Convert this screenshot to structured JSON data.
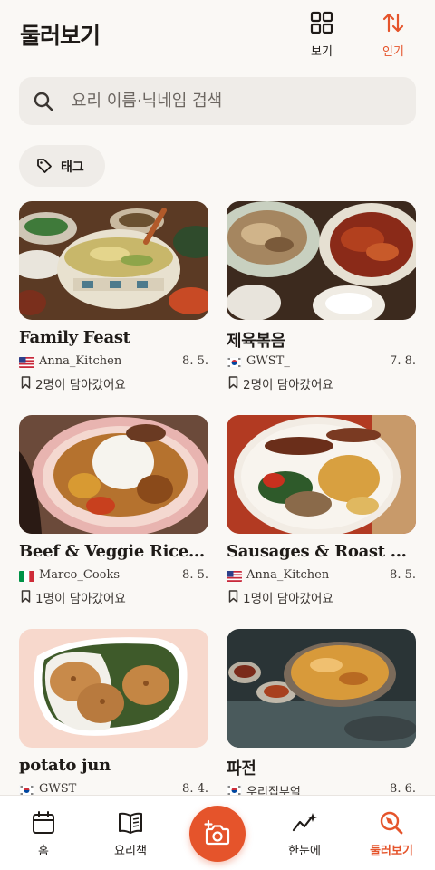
{
  "header": {
    "title": "둘러보기",
    "view_label": "보기",
    "popular_label": "인기"
  },
  "search": {
    "placeholder": "요리 이름·닉네임 검색"
  },
  "tag_filter": {
    "label": "태그"
  },
  "cards": [
    {
      "title": "Family Feast",
      "flag": "us",
      "author": "Anna_Kitchen",
      "date": "8. 5.",
      "saved": "2명이 담아갔어요"
    },
    {
      "title": "제육볶음",
      "flag": "kr",
      "author": "GWST_",
      "date": "7. 8.",
      "saved": "2명이 담아갔어요"
    },
    {
      "title": "Beef & Veggie Rice...",
      "flag": "it",
      "author": "Marco_Cooks",
      "date": "8. 5.",
      "saved": "1명이 담아갔어요"
    },
    {
      "title": "Sausages & Roast ...",
      "flag": "us",
      "author": "Anna_Kitchen",
      "date": "8. 5.",
      "saved": "1명이 담아갔어요"
    },
    {
      "title": "potato jun",
      "flag": "kr",
      "author": "GWST",
      "date": "8. 4.",
      "saved": ""
    },
    {
      "title": "파전",
      "flag": "kr",
      "author": "우리집부엌",
      "date": "8. 6.",
      "saved": ""
    }
  ],
  "tabbar": {
    "home": "홈",
    "recipe_book": "요리책",
    "overview": "한눈에",
    "explore": "둘러보기"
  },
  "colors": {
    "accent": "#e5542b",
    "background": "#faf8f5",
    "chip": "#efece8"
  }
}
